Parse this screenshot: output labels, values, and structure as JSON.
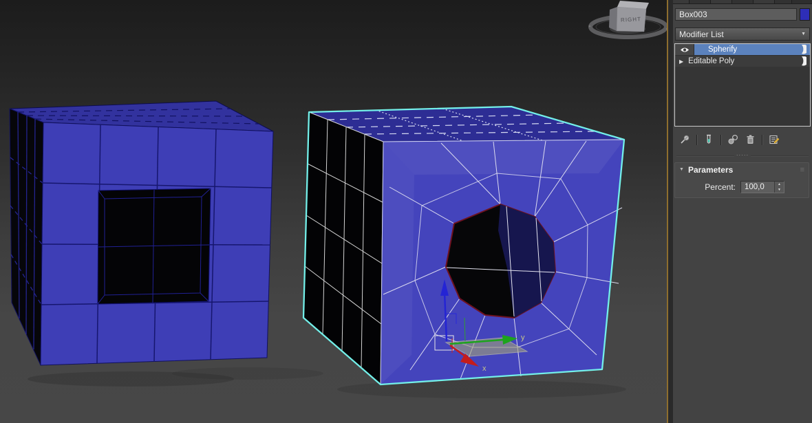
{
  "viewport": {
    "viewcube": {
      "label": "RIGHT"
    },
    "gizmo": {
      "x_label": "x",
      "y_label": "y"
    }
  },
  "panel": {
    "object_name_field": {
      "value": "Box003"
    },
    "object_color_swatch": {
      "color": "#2e2eb8"
    },
    "modifier_list": {
      "label": "Modifier List"
    },
    "modifier_stack": {
      "items": [
        {
          "label": "Spherify",
          "selected": true
        },
        {
          "label": "Editable Poly",
          "selected": false
        }
      ]
    },
    "stack_toolbar_icons": [
      "pin-stack",
      "show-end-result",
      "make-unique",
      "remove-modifier",
      "configure-modifier-sets"
    ],
    "parameters_rollout": {
      "title": "Parameters",
      "percent_label": "Percent:",
      "percent_value": "100,0"
    }
  },
  "colors": {
    "selection_highlight": "#5b82bd",
    "selected_outline_cyan": "#73efe9",
    "viewport_active_border": "#8e6e2e",
    "object_blue": "#4444bc"
  }
}
